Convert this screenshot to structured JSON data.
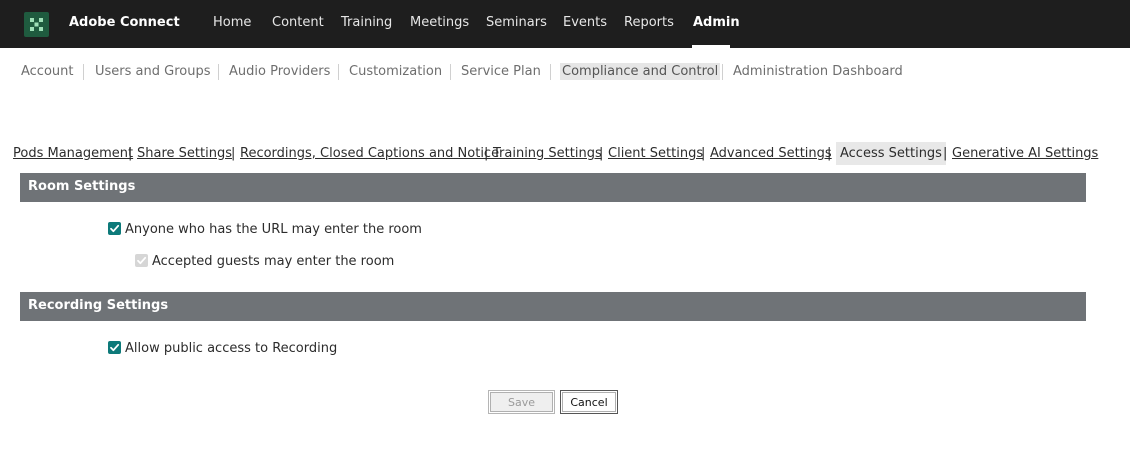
{
  "app": {
    "name": "Adobe Connect",
    "logo_icon": "adobe-connect-logo-icon",
    "logo_color": "#1f5b3f"
  },
  "top_nav": {
    "items": [
      {
        "label": "Home",
        "active": false
      },
      {
        "label": "Content",
        "active": false
      },
      {
        "label": "Training",
        "active": false
      },
      {
        "label": "Meetings",
        "active": false
      },
      {
        "label": "Seminars",
        "active": false
      },
      {
        "label": "Events",
        "active": false
      },
      {
        "label": "Reports",
        "active": false
      },
      {
        "label": "Admin",
        "active": true
      }
    ]
  },
  "admin_nav": {
    "items": [
      {
        "label": "Account"
      },
      {
        "label": "Users and Groups"
      },
      {
        "label": "Audio Providers"
      },
      {
        "label": "Customization"
      },
      {
        "label": "Service Plan"
      },
      {
        "label": "Compliance and Control",
        "selected": true
      },
      {
        "label": "Administration Dashboard"
      }
    ]
  },
  "settings_tabs": {
    "items": [
      {
        "label": "Pods Management"
      },
      {
        "label": "Share Settings"
      },
      {
        "label": "Recordings, Closed Captions and Notice"
      },
      {
        "label": "Training Settings"
      },
      {
        "label": "Client Settings"
      },
      {
        "label": "Advanced Settings"
      },
      {
        "label": "Access Settings",
        "current": true
      },
      {
        "label": "Generative AI Settings"
      }
    ],
    "separator": "|"
  },
  "room_settings": {
    "title": "Room Settings",
    "options": [
      {
        "label": "Anyone who has the URL may enter the room",
        "checked": true,
        "disabled": false
      },
      {
        "label": "Accepted guests may enter the room",
        "checked": true,
        "disabled": true
      }
    ]
  },
  "recording_settings": {
    "title": "Recording Settings",
    "options": [
      {
        "label": "Allow public access to Recording",
        "checked": true,
        "disabled": false
      }
    ]
  },
  "actions": {
    "save_label": "Save",
    "cancel_label": "Cancel",
    "save_disabled": true
  },
  "colors": {
    "topbar": "#1e1e1e",
    "section_header": "#6f7377",
    "checkbox": "#0d7a7a"
  }
}
